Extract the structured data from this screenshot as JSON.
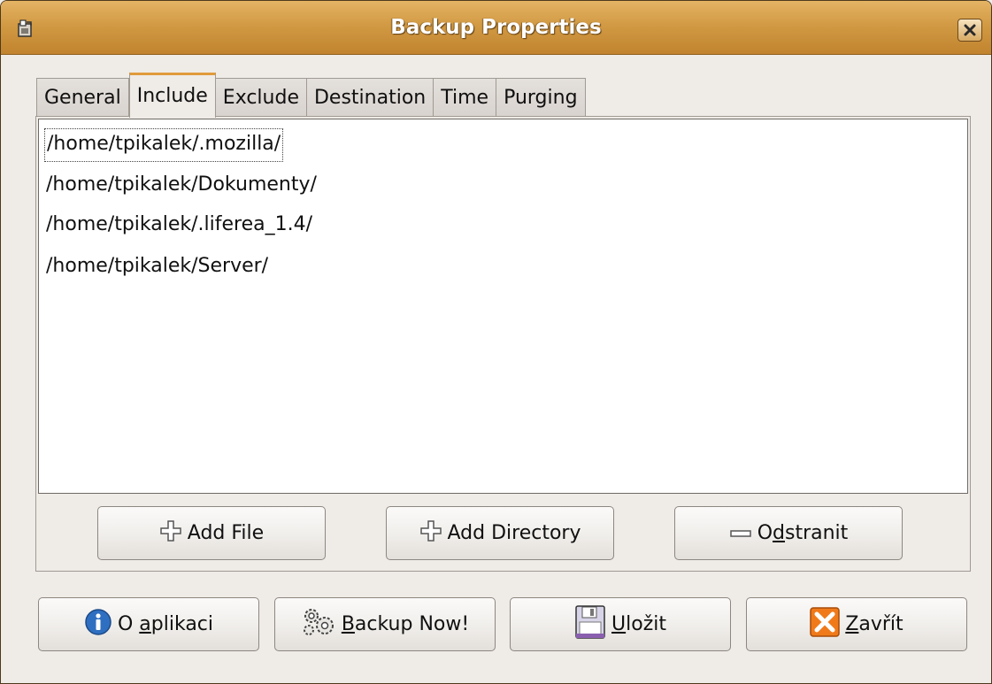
{
  "window": {
    "title": "Backup Properties"
  },
  "tabs": [
    {
      "label": "General"
    },
    {
      "label": "Include"
    },
    {
      "label": "Exclude"
    },
    {
      "label": "Destination"
    },
    {
      "label": "Time"
    },
    {
      "label": "Purging"
    }
  ],
  "active_tab": "Include",
  "include_list": [
    "/home/tpikalek/.mozilla/",
    "/home/tpikalek/Dokumenty/",
    "/home/tpikalek/.liferea_1.4/",
    "/home/tpikalek/Server/"
  ],
  "panel_buttons": {
    "add_file": "Add File",
    "add_directory": "Add Directory",
    "remove_pre": "O",
    "remove_mnemonic": "d",
    "remove_post": "stranit"
  },
  "footer_buttons": {
    "about_pre": "O ",
    "about_mnemonic": "a",
    "about_post": "plikaci",
    "backup_mnemonic": "B",
    "backup_post": "ackup Now!",
    "save_mnemonic": "U",
    "save_post": "ložit",
    "close_mnemonic": "Z",
    "close_post": "avřít"
  },
  "icons": {
    "app": "app-icon",
    "close": "close-icon",
    "add": "plus-icon",
    "remove": "minus-icon",
    "about": "info-icon",
    "backup": "gears-icon",
    "save": "floppy-icon",
    "quit": "x-icon"
  },
  "colors": {
    "titlebar": "#d29a44",
    "tab_accent": "#e09b3c",
    "info_blue": "#2f6fc1",
    "close_orange": "#f07a1a"
  }
}
